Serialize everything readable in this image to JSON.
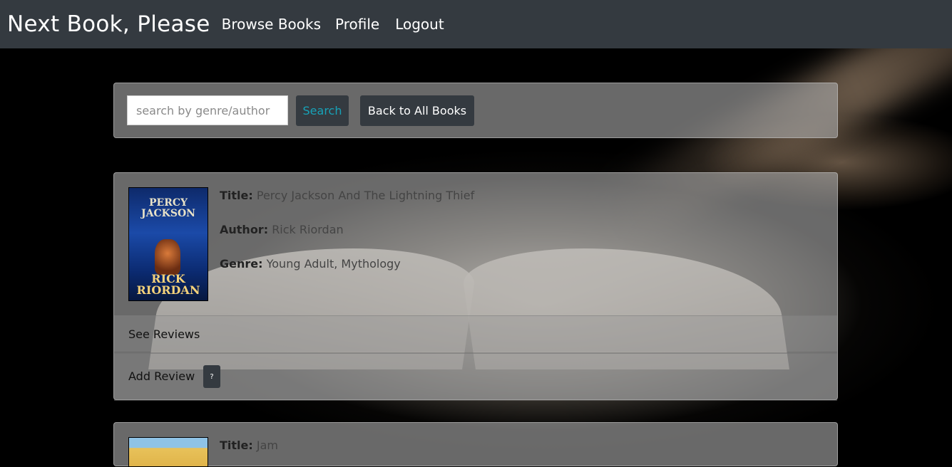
{
  "nav": {
    "brand": "Next Book, Please",
    "links": [
      "Browse Books",
      "Profile",
      "Logout"
    ]
  },
  "search": {
    "placeholder": "search by genre/author",
    "value": "",
    "search_label": "Search",
    "back_label": "Back to All Books"
  },
  "books": [
    {
      "title_label": "Title:",
      "title": "Percy Jackson And The Lightning Thief",
      "author_label": "Author:",
      "author": "Rick Riordan",
      "genre_label": "Genre:",
      "genre": "Young Adult, Mythology",
      "cover_text_title": "PERCY JACKSON",
      "cover_text_author": "RICK RIORDAN",
      "see_reviews": "See Reviews",
      "add_review": "Add Review",
      "help": "?"
    },
    {
      "title_label": "Title:",
      "title": "Jam"
    }
  ],
  "colors": {
    "navbar": "#343a40",
    "search_text": "#17a2b8",
    "panel": "rgba(170,170,170,.62)"
  }
}
